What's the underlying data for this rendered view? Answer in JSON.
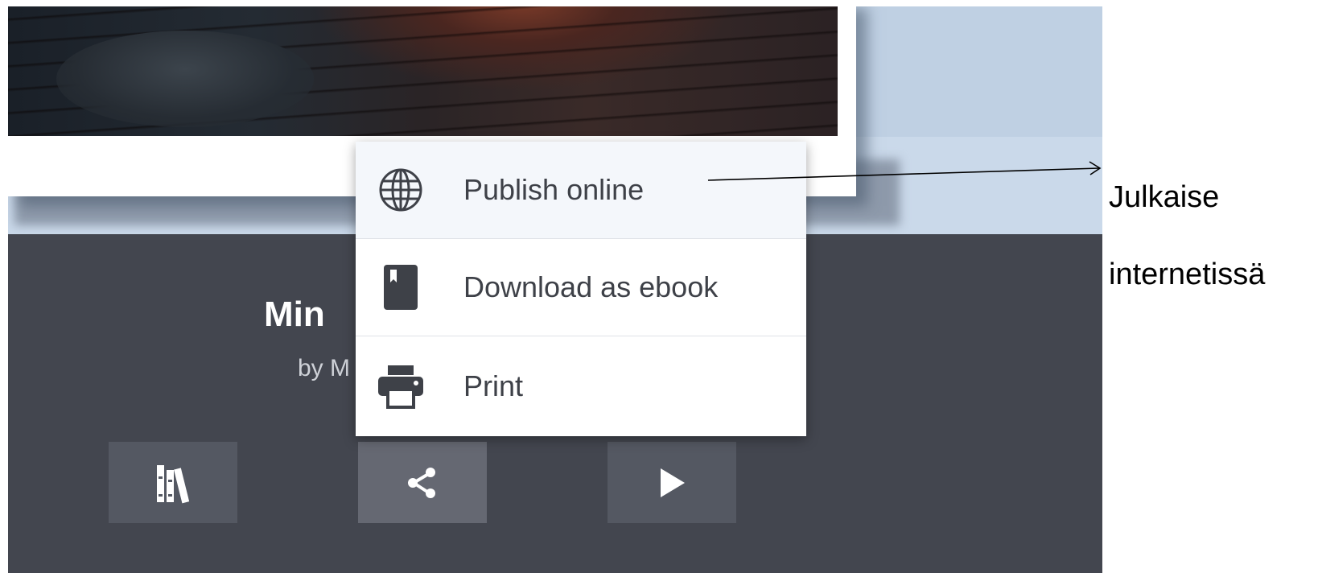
{
  "book": {
    "title": "Min",
    "author": "by M"
  },
  "toolbar": {
    "library_icon": "library-books-icon",
    "share_icon": "share-icon",
    "play_icon": "play-icon"
  },
  "share_menu": {
    "items": [
      {
        "label": "Publish online",
        "icon": "globe-icon"
      },
      {
        "label": "Download as ebook",
        "icon": "ebook-icon"
      },
      {
        "label": "Print",
        "icon": "printer-icon"
      }
    ]
  },
  "annotation": {
    "line1": "Julkaise",
    "line2": "internetissä"
  },
  "colors": {
    "panel": "#43464f",
    "button": "#545862",
    "button_active": "#656872",
    "menu_text": "#3e4148",
    "background": "#bfd0e3"
  }
}
